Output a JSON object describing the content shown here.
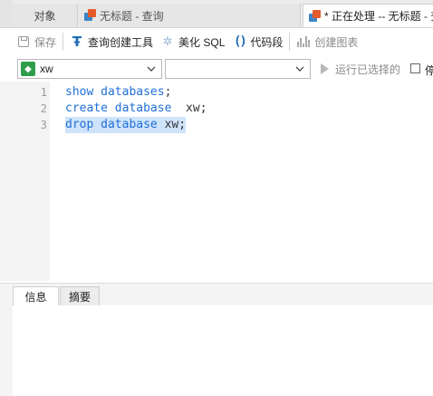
{
  "tabs": [
    {
      "label": "对象"
    },
    {
      "label": "无标题 - 查询"
    },
    {
      "label": "* 正在处理 -- 无标题 - 查询"
    }
  ],
  "toolbar": {
    "save": "保存",
    "query_builder": "查询创建工具",
    "beautify": "美化 SQL",
    "snippet": "代码段",
    "create_chart": "创建图表"
  },
  "selectors": {
    "database": "xw",
    "schema": "",
    "run_selected": "运行已选择的",
    "checkbox_label": "停"
  },
  "editor": {
    "lines": [
      {
        "num": "1",
        "kw": "show databases",
        "rest": ";"
      },
      {
        "num": "2",
        "kw": "create database",
        "rest": "  xw;"
      },
      {
        "num": "3",
        "kw": "drop database",
        "rest": " xw;"
      }
    ],
    "highlighted_line": 3
  },
  "results": {
    "tabs": [
      {
        "label": "信息"
      },
      {
        "label": "摘要"
      }
    ]
  },
  "colors": {
    "keyword": "#1e6fd9",
    "selection": "#cfe3fa",
    "db_icon": "#2f9e4a"
  },
  "icons": [
    "save-icon",
    "query-builder-icon",
    "beautify-icon",
    "snippet-icon",
    "chart-icon",
    "database-icon",
    "chevron-down-icon",
    "play-icon"
  ]
}
